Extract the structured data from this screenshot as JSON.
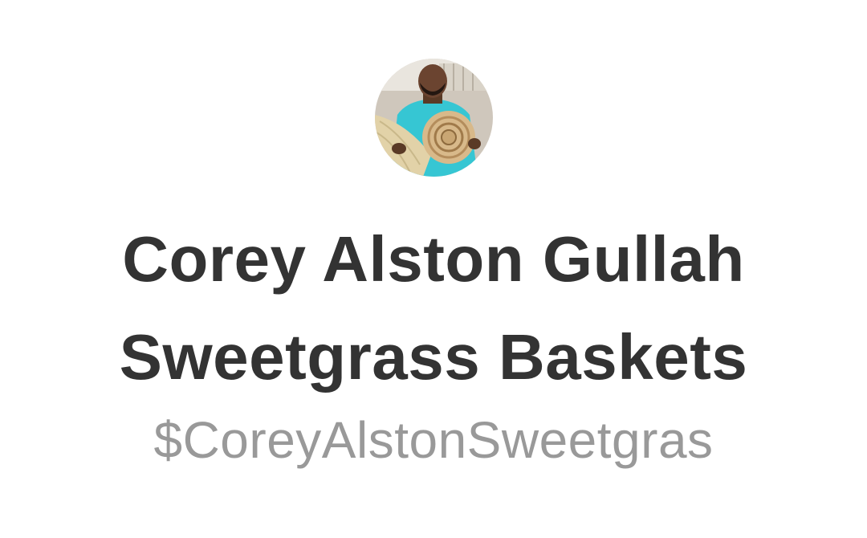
{
  "profile": {
    "avatar_alt": "",
    "name_line_1": "Corey Alston Gullah",
    "name_line_2": "Sweetgrass Baskets",
    "cashtag": "$CoreyAlstonSweetgras"
  },
  "colors": {
    "name_text": "#333333",
    "cashtag_text": "#999999",
    "background": "#ffffff"
  }
}
